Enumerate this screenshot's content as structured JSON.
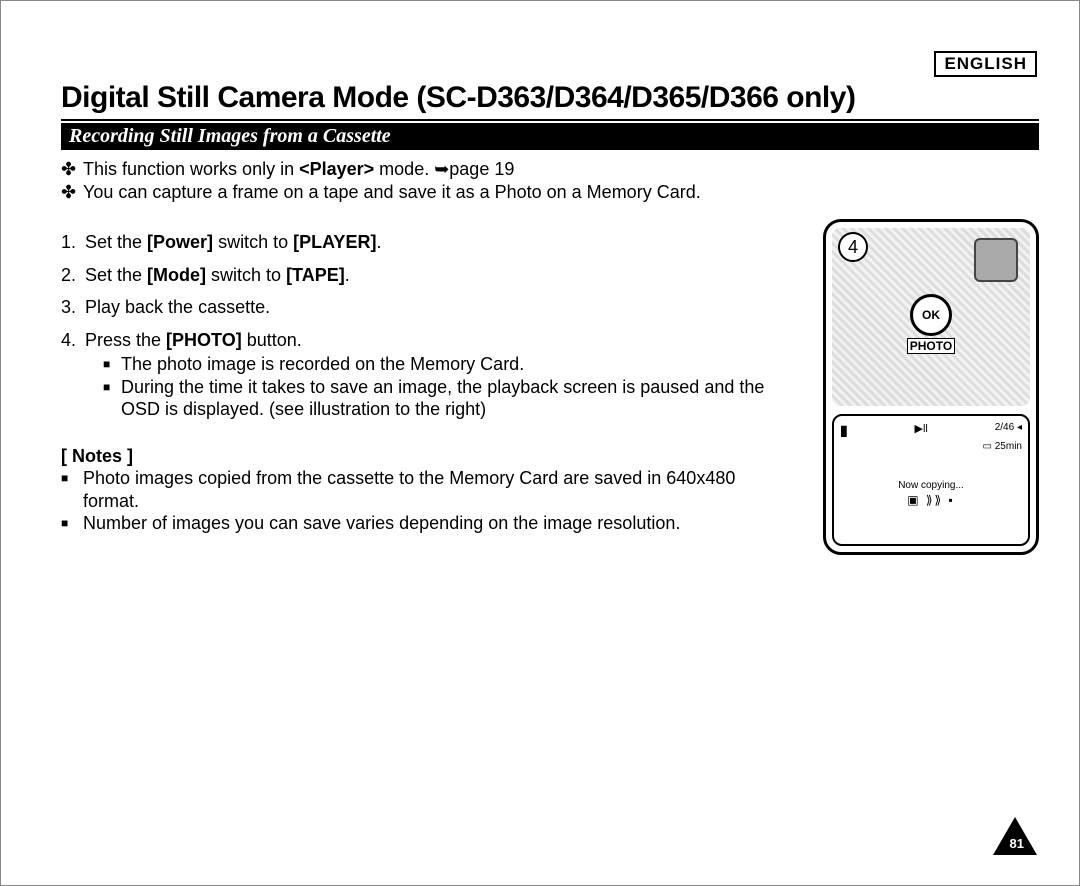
{
  "language_label": "ENGLISH",
  "page_title": "Digital Still Camera Mode (SC-D363/D364/D365/D366 only)",
  "section_heading": "Recording Still Images from a Cassette",
  "intro": [
    {
      "prefix": "This function works only in ",
      "bold": "<Player>",
      "suffix": " mode. ➥page 19"
    },
    {
      "text": "You can capture a frame on a tape and save it as a Photo on a Memory Card."
    }
  ],
  "steps": [
    {
      "num": "1.",
      "pre": "Set the ",
      "b1": "[Power]",
      "mid": " switch to ",
      "b2": "[PLAYER]",
      "post": "."
    },
    {
      "num": "2.",
      "pre": "Set the ",
      "b1": "[Mode]",
      "mid": " switch to ",
      "b2": "[TAPE]",
      "post": "."
    },
    {
      "num": "3.",
      "text": "Play back the cassette."
    },
    {
      "num": "4.",
      "pre": "Press the ",
      "b1": "[PHOTO]",
      "post": " button."
    }
  ],
  "step4_sub": [
    "The photo image is recorded on the Memory Card.",
    "During the time it takes to save an image, the playback screen is paused and the OSD is displayed. (see illustration to the right)"
  ],
  "notes_heading": "[ Notes ]",
  "notes": [
    "Photo images copied from the cassette to the Memory Card are saved in 640x480 format.",
    "Number of images you can save varies depending on the image resolution."
  ],
  "illustration": {
    "step_circle": "4",
    "ok_label": "OK",
    "photo_label": "PHOTO",
    "osd_counter": "2/46",
    "osd_time": "25min",
    "osd_status": "Now copying...",
    "cassette_sym": "▣ ⟫⟫ ▪"
  },
  "page_number": "81"
}
